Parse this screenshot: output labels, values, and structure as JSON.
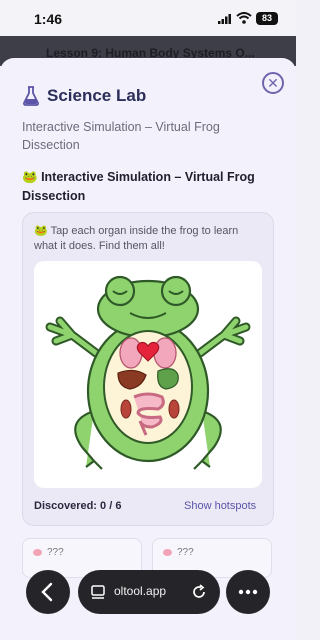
{
  "status_bar": {
    "time": "1:46",
    "battery": "83"
  },
  "behind_title": "Lesson 9: Human Body Systems O...",
  "header": {
    "title": "Science Lab",
    "subtitle": "Interactive Simulation – Virtual Frog Dissection"
  },
  "section": {
    "emoji": "🐸",
    "title": "Interactive Simulation – Virtual Frog Dissection"
  },
  "simulation": {
    "instruction_emoji": "🐸",
    "instruction": "Tap each organ inside the frog to learn what it does. Find them all!",
    "discovered_label": "Discovered: 0 / 6",
    "show_hotspots": "Show hotspots"
  },
  "organ_cards": [
    {
      "label": "???"
    },
    {
      "label": "???"
    }
  ],
  "browser": {
    "url": "oltool.app"
  },
  "colors": {
    "accent": "#5b54a8",
    "frog": "#8fd36f",
    "frog_dark": "#3a6b30",
    "heart": "#e5233a"
  }
}
